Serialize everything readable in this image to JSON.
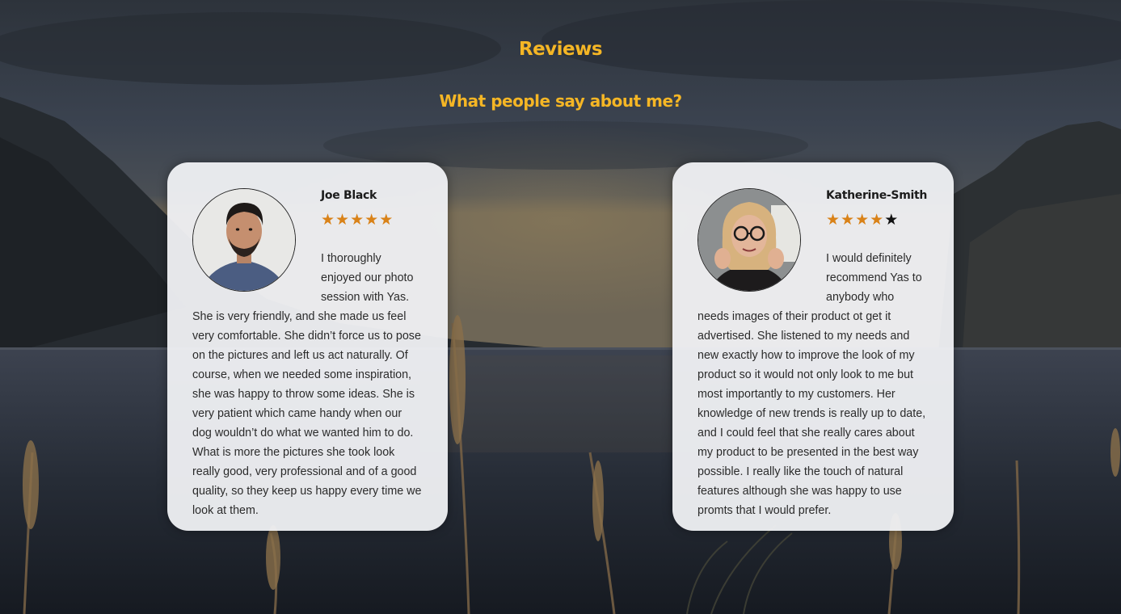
{
  "section": {
    "title": "Reviews",
    "subtitle": "What people say about me?"
  },
  "reviews": [
    {
      "name": "Joe Black",
      "rating": 5,
      "max_rating": 5,
      "text": "I thoroughly enjoyed our photo session with Yas. She is very friendly, and she made us feel very comfortable. She didn’t force us to pose on the pictures and left us act naturally. Of course, when we needed some inspiration, she was happy to throw some ideas. She is very patient which came handy when our dog wouldn’t do what we wanted him to do. What is more the pictures she took look really good, very professional and of a good quality, so they keep us happy every time we look at them."
    },
    {
      "name": "Katherine-Smith",
      "rating": 4,
      "max_rating": 5,
      "text": "I would definitely recommend Yas to anybody who needs images of their product ot get it advertised. She listened to my needs and new exactly how to improve the look of my product so it would not only look to me but most importantly to my customers. Her knowledge of new trends is really up to date, and I could feel that she really cares about my product to be presented in the best way possible. I really like the touch of natural features although she was happy to use promts that I would prefer."
    }
  ],
  "colors": {
    "accent": "#f5b625",
    "star_filled": "#d98218",
    "star_empty": "#111111",
    "card_bg": "#f0f1f4"
  }
}
